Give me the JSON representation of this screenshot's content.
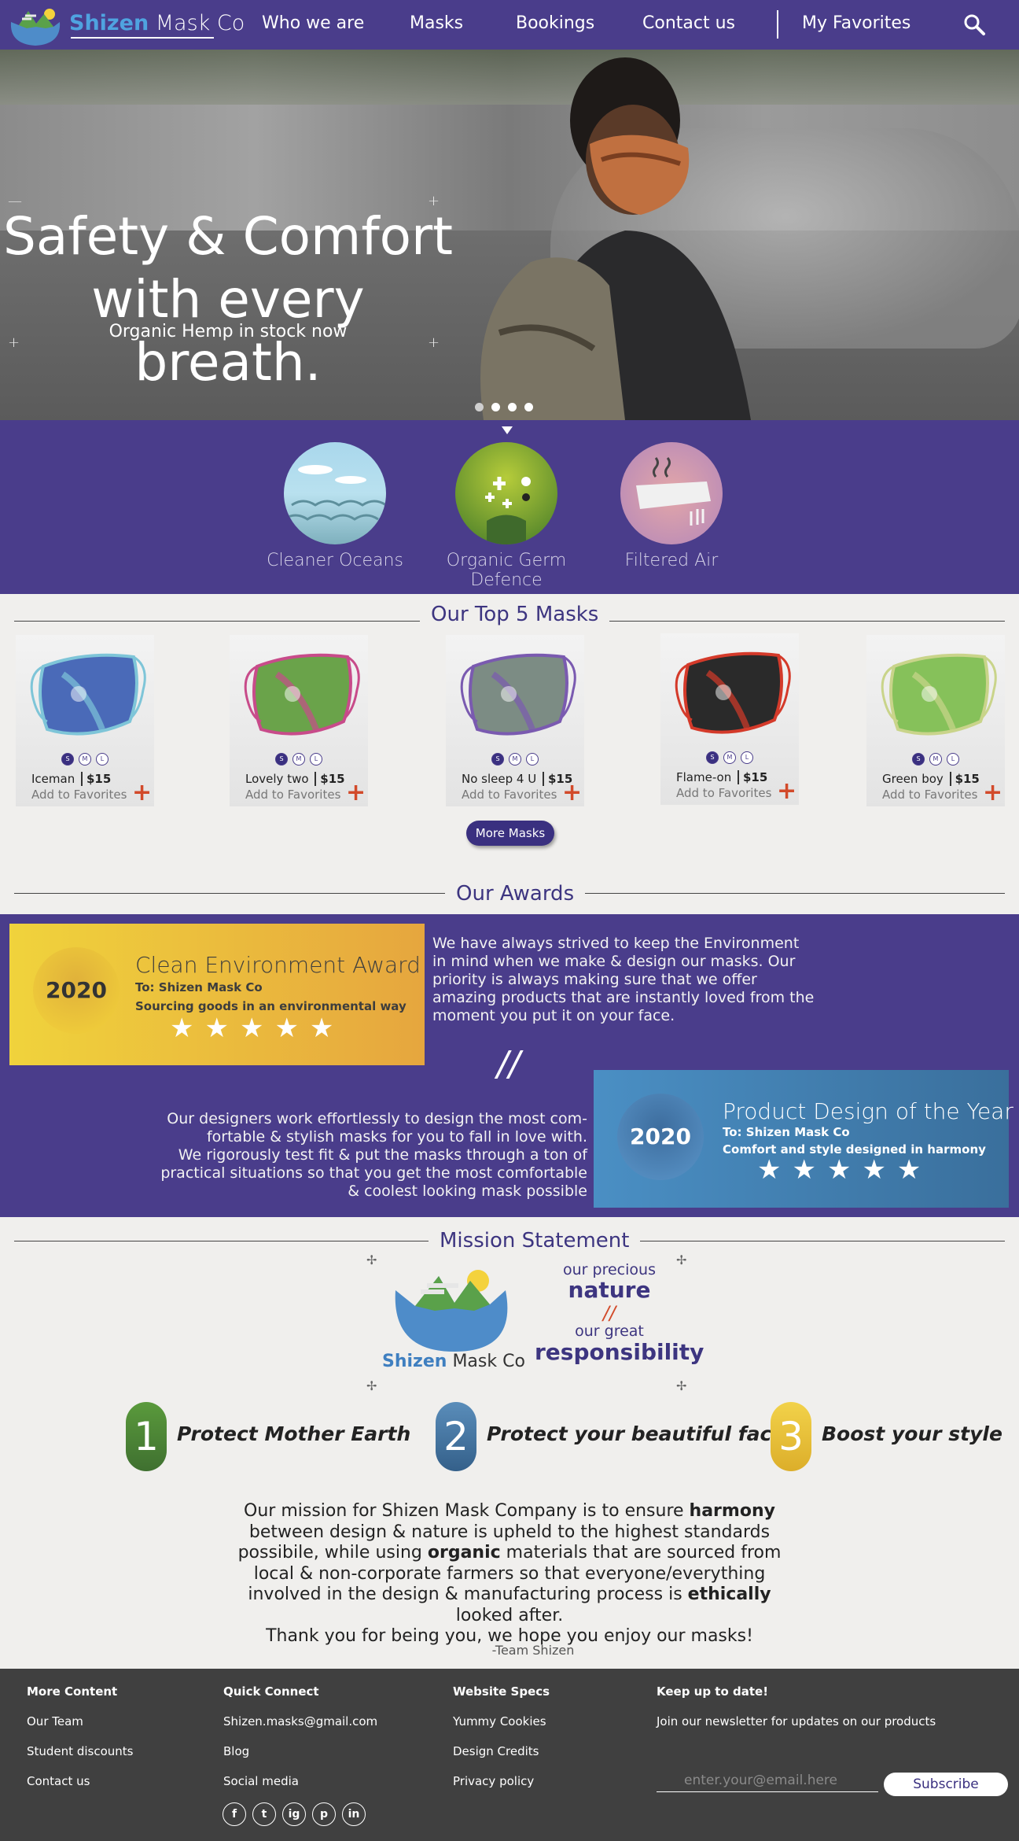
{
  "nav": {
    "brand_first": "Shizen",
    "brand_second": "Mask Co",
    "links": [
      "Who we are",
      "Masks",
      "Bookings",
      "Contact us"
    ],
    "favorites": "My Favorites"
  },
  "hero": {
    "title_line1": "Safety & Comfort",
    "title_line2": "with every breath.",
    "subtitle": "Organic Hemp in stock now",
    "slides": 4,
    "active_slide": 1
  },
  "features": [
    {
      "label": "Cleaner Oceans"
    },
    {
      "label": "Organic Germ Defence"
    },
    {
      "label": "Filtered Air"
    }
  ],
  "top_masks": {
    "title": "Our Top 5 Masks",
    "sizes": [
      "S",
      "M",
      "L"
    ],
    "add_label": "Add to Favorites",
    "items": [
      {
        "name": "Iceman",
        "price": "$15",
        "color": "#4a6ab8",
        "accent": "#7ec5d8"
      },
      {
        "name": "Lovely two",
        "price": "$15",
        "color": "#6aa34a",
        "accent": "#c84b8a"
      },
      {
        "name": "No sleep 4 U",
        "price": "$15",
        "color": "#7c8c84",
        "accent": "#7a5ab0"
      },
      {
        "name": "Flame-on",
        "price": "$15",
        "color": "#2a2a2a",
        "accent": "#d43a2a"
      },
      {
        "name": "Green boy",
        "price": "$15",
        "color": "#86c15a",
        "accent": "#c9d48a"
      }
    ],
    "more_label": "More Masks"
  },
  "awards": {
    "title": "Our Awards",
    "items": [
      {
        "year": "2020",
        "title": "Clean Environment Award",
        "to": "To: Shizen Mask Co",
        "sub": "Sourcing goods in an environmental way",
        "stars": "★★★★★"
      },
      {
        "year": "2020",
        "title": "Product Design of the Year",
        "to": "To: Shizen Mask Co",
        "sub": "Comfort and style designed in harmony",
        "stars": "★★★★★"
      }
    ],
    "text1": [
      "We have always strived to keep the Environment",
      "in mind when we make & design our masks. Our",
      "priority is always making sure that we offer",
      "amazing products that are instantly loved from the",
      "moment you put it on your face."
    ],
    "divider": "//",
    "text2": [
      "Our designers work effortlessly to design the most com-",
      "fortable & stylish masks for you to fall in love with.",
      "We rigorously test fit & put the masks through a  ton of",
      "practical situations so that you get the most comfortable",
      "& coolest looking mask possible"
    ]
  },
  "mission": {
    "title": "Mission Statement",
    "logo_first": "Shizen",
    "logo_second": "Mask Co",
    "tag1": "our precious",
    "tag2": "nature",
    "tag3": "//",
    "tag4": "our great",
    "tag5": "responsibility",
    "steps": [
      {
        "num": "1",
        "text": "Protect Mother Earth",
        "color": "#4a8a3c"
      },
      {
        "num": "2",
        "text": "Protect your beautiful face",
        "color": "#3f6f9a"
      },
      {
        "num": "3",
        "text": "Boost your style",
        "color": "#eac43a"
      }
    ],
    "para": {
      "a": "Our mission for Shizen Mask Company is to ensure ",
      "b": "harmony",
      "c": " between design & nature is upheld to the highest standards possibile, while using ",
      "d": "organic",
      "e": " materials that are sourced from local & non-corporate farmers so that everyone/everything involved in the design & manufacturing process is ",
      "f": "ethically",
      "g": " looked after.",
      "h": "Thank you for being you, we hope you enjoy our masks!"
    },
    "signature": "-Team Shizen"
  },
  "footer": {
    "col1": {
      "title": "More Content",
      "items": [
        "Our Team",
        "Student discounts",
        "Contact us"
      ]
    },
    "col2": {
      "title": "Quick Connect",
      "items": [
        "Shizen.masks@gmail.com",
        "Blog",
        "Social media"
      ]
    },
    "col3": {
      "title": "Website Specs",
      "items": [
        "Yummy Cookies",
        "Design Credits",
        "Privacy policy"
      ]
    },
    "col4": {
      "title": "Keep up to date!",
      "text": "Join our newsletter for updates on our products"
    },
    "email_placeholder": "enter.your@email.here",
    "subscribe": "Subscribe",
    "social": [
      "f",
      "t",
      "ig",
      "p",
      "in"
    ]
  }
}
